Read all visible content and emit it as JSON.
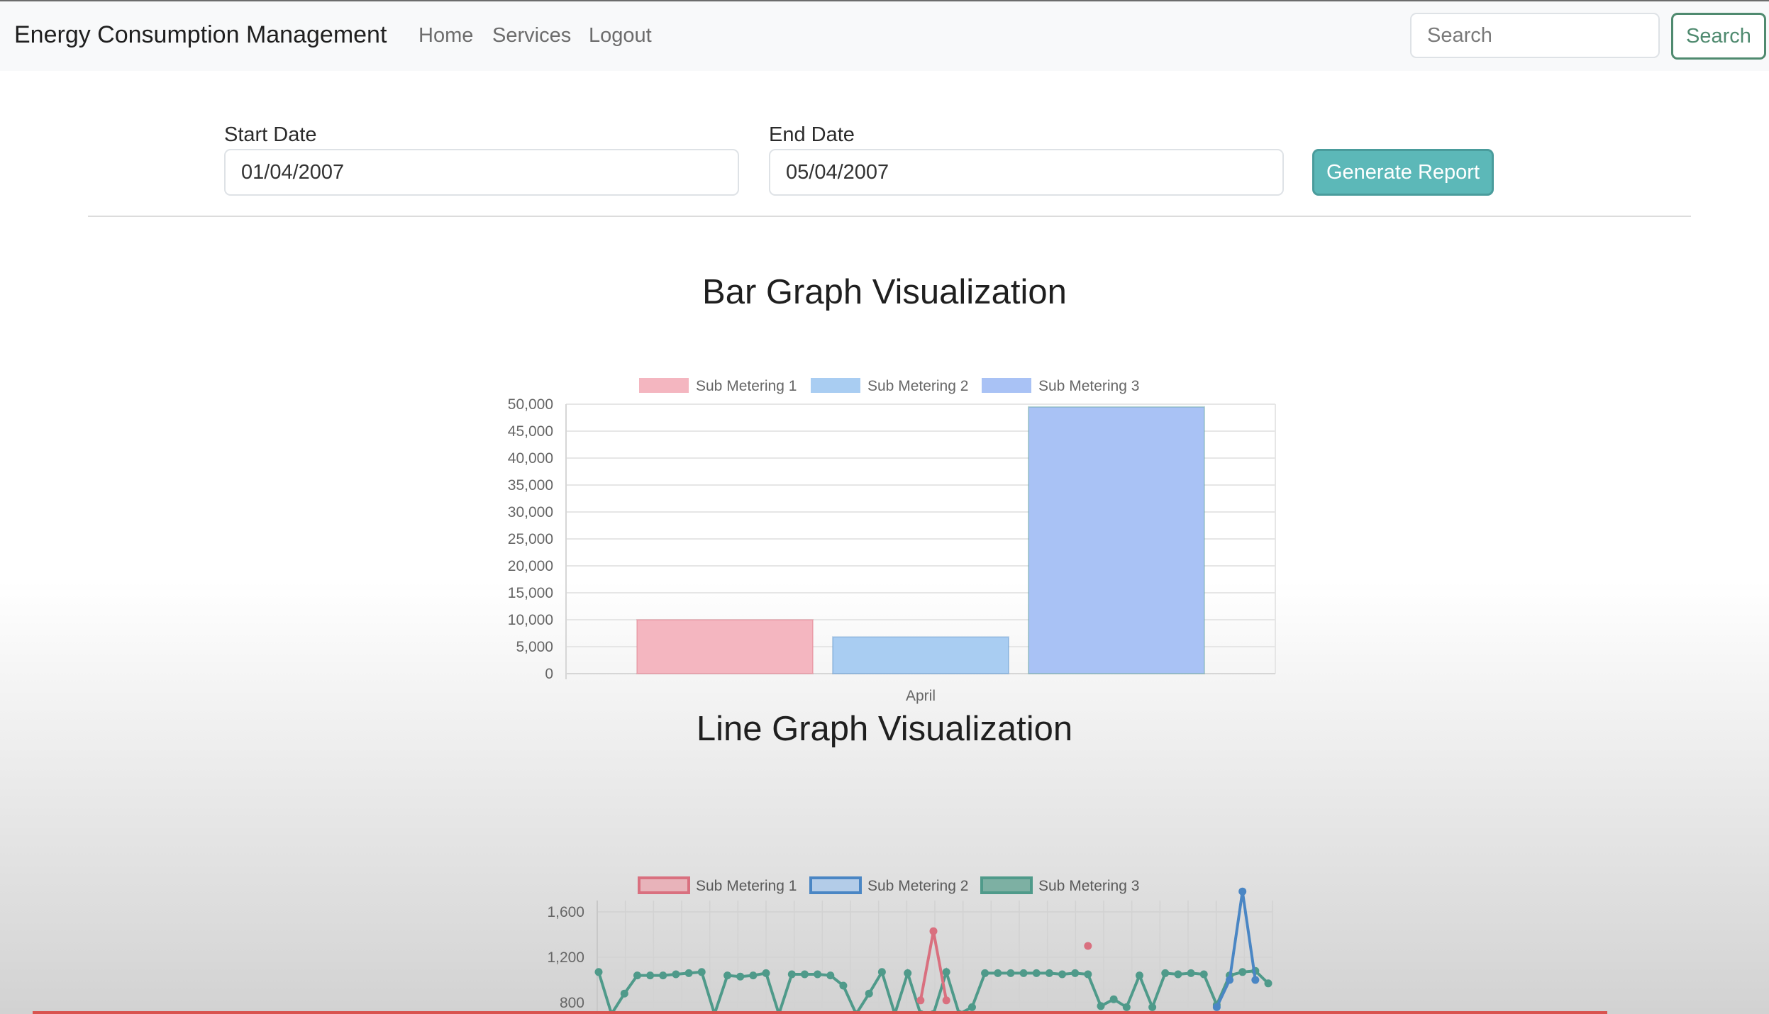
{
  "navbar": {
    "brand": "Energy Consumption Management",
    "links": [
      "Home",
      "Services",
      "Logout"
    ],
    "search_placeholder": "Search",
    "search_button": "Search"
  },
  "form": {
    "start_label": "Start Date",
    "start_value": "01/04/2007",
    "end_label": "End Date",
    "end_value": "05/04/2007",
    "generate_button": "Generate Report"
  },
  "bar_section": {
    "title": "Bar Graph Visualization"
  },
  "line_section": {
    "title": "Line Graph Visualization"
  },
  "colors": {
    "sub1_fill": "#f4b6c0",
    "sub2_fill": "#a9cdf2",
    "sub3_fill": "#a9c2f5",
    "sub1_line": "#d9707f",
    "sub2_line": "#4a86c4",
    "sub3_line": "#4f9a8a",
    "primary_teal": "#5cb8b8"
  },
  "chart_data": [
    {
      "type": "bar",
      "title": "",
      "categories": [
        "April"
      ],
      "series": [
        {
          "name": "Sub Metering 1",
          "values": [
            10000
          ]
        },
        {
          "name": "Sub Metering 2",
          "values": [
            6800
          ]
        },
        {
          "name": "Sub Metering 3",
          "values": [
            49500
          ]
        }
      ],
      "yticks": [
        "0",
        "5,000",
        "10,000",
        "15,000",
        "20,000",
        "25,000",
        "30,000",
        "35,000",
        "40,000",
        "45,000",
        "50,000"
      ],
      "ylim": [
        0,
        50000
      ],
      "xlabel": "",
      "ylabel": "",
      "grid": true,
      "legend": "top-center"
    },
    {
      "type": "line",
      "title": "",
      "yticks": [
        "800",
        "1,200",
        "1,600"
      ],
      "ylim": [
        700,
        1700
      ],
      "grid": true,
      "legend": "top-center",
      "series": [
        {
          "name": "Sub Metering 1",
          "values": [
            null,
            null,
            null,
            null,
            null,
            null,
            null,
            null,
            null,
            null,
            null,
            null,
            null,
            null,
            null,
            null,
            null,
            null,
            null,
            null,
            null,
            null,
            null,
            null,
            null,
            820,
            1430,
            820,
            null,
            null,
            null,
            null,
            null,
            null,
            null,
            null,
            null,
            null,
            1300,
            null,
            null,
            null,
            null,
            null,
            null,
            null,
            null,
            null,
            null,
            null,
            null,
            null,
            null
          ]
        },
        {
          "name": "Sub Metering 2",
          "values": [
            null,
            null,
            null,
            null,
            null,
            null,
            null,
            null,
            null,
            null,
            null,
            null,
            null,
            null,
            null,
            null,
            null,
            null,
            null,
            null,
            null,
            null,
            null,
            null,
            null,
            null,
            null,
            null,
            null,
            null,
            null,
            null,
            null,
            null,
            null,
            null,
            null,
            null,
            null,
            null,
            null,
            null,
            null,
            null,
            null,
            null,
            null,
            null,
            760,
            1000,
            1780,
            1000,
            null
          ]
        },
        {
          "name": "Sub Metering 3",
          "values": [
            1070,
            700,
            880,
            1040,
            1040,
            1040,
            1050,
            1060,
            1070,
            700,
            1040,
            1030,
            1040,
            1060,
            700,
            1050,
            1050,
            1050,
            1040,
            950,
            700,
            880,
            1070,
            700,
            1060,
            700,
            700,
            1070,
            700,
            760,
            1060,
            1060,
            1060,
            1060,
            1060,
            1060,
            1050,
            1060,
            1050,
            770,
            830,
            760,
            1040,
            760,
            1060,
            1050,
            1060,
            1050,
            780,
            1040,
            1070,
            1080,
            970
          ]
        }
      ]
    }
  ]
}
